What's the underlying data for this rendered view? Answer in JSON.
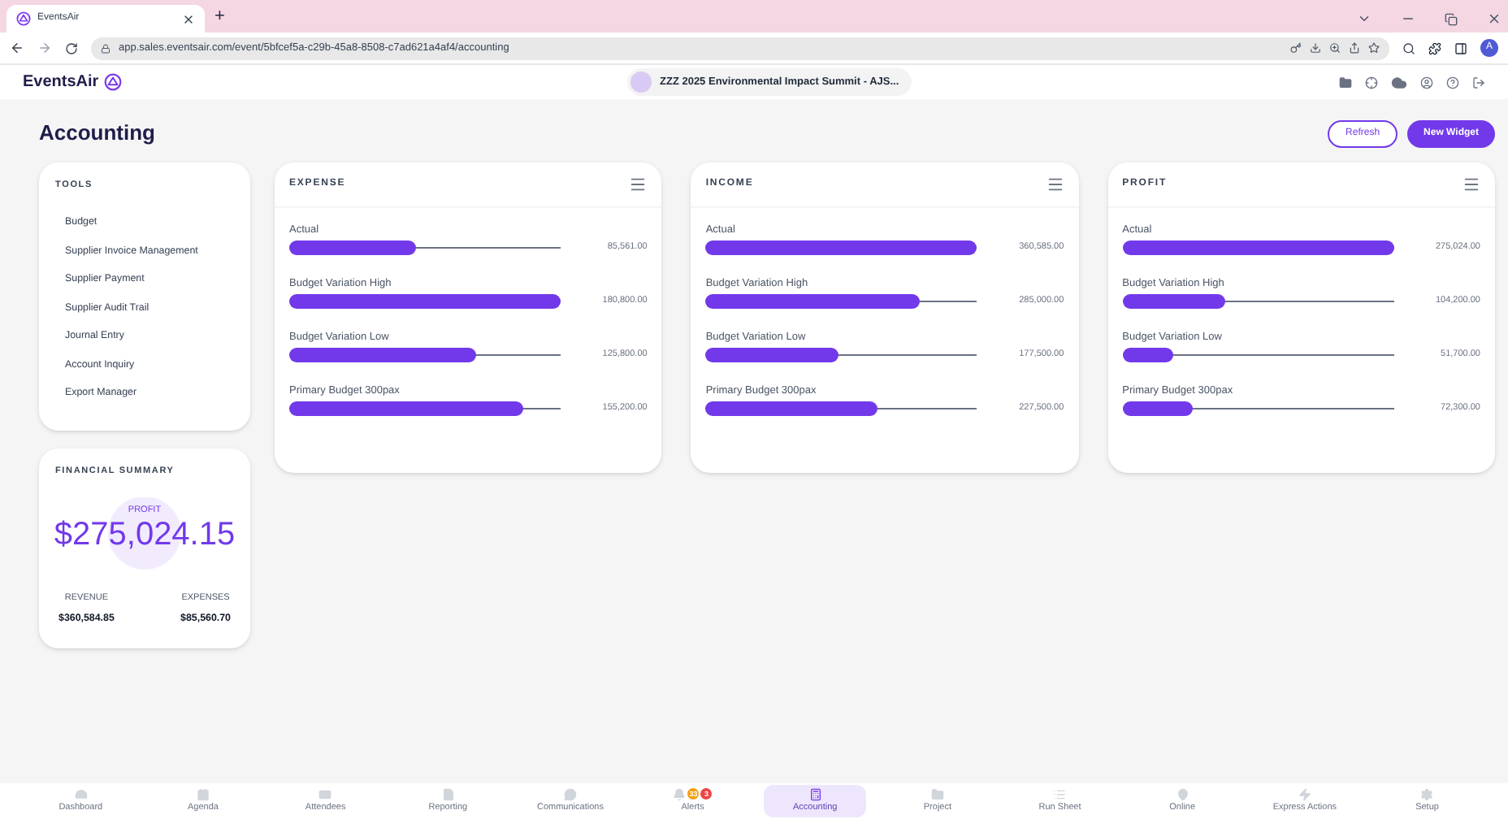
{
  "browser": {
    "tab_title": "EventsAir",
    "new_tab": "+",
    "url": "app.sales.eventsair.com/event/5bfcef5a-c29b-45a8-8508-c7ad621a4af4/accounting",
    "profile": "A"
  },
  "app": {
    "brand": "EventsAir",
    "event": "ZZZ 2025 Environmental Impact Summit - AJS..."
  },
  "page": {
    "title": "Accounting",
    "buttons": [
      {
        "label": "Refresh",
        "kind": "outline"
      },
      {
        "label": "New Widget",
        "kind": "primary"
      }
    ]
  },
  "tools": {
    "title": "TOOLS",
    "items": [
      "Budget",
      "Supplier Invoice Management",
      "Supplier Payment",
      "Supplier Audit Trail",
      "Journal Entry",
      "Account Inquiry",
      "Export Manager"
    ]
  },
  "financial_summary": {
    "title": "FINANCIAL SUMMARY",
    "profit_label": "PROFIT",
    "profit": "$275,024.15",
    "revenue_label": "REVENUE",
    "revenue": "$360,584.85",
    "expenses_label": "EXPENSES",
    "expenses": "$85,560.70"
  },
  "widgets": [
    {
      "title": "EXPENSE",
      "rows": [
        {
          "label": "Actual",
          "level": 0.47,
          "value": "85,561.00"
        },
        {
          "label": "Budget Variation High",
          "level": 1.0,
          "value": "180,800.00"
        },
        {
          "label": "Budget Variation Low",
          "level": 0.69,
          "value": "125,800.00"
        },
        {
          "label": "Primary Budget 300pax",
          "level": 0.86,
          "value": "155,200.00"
        }
      ]
    },
    {
      "title": "INCOME",
      "rows": [
        {
          "label": "Actual",
          "level": 1.0,
          "value": "360,585.00"
        },
        {
          "label": "Budget Variation High",
          "level": 0.79,
          "value": "285,000.00"
        },
        {
          "label": "Budget Variation Low",
          "level": 0.49,
          "value": "177,500.00"
        },
        {
          "label": "Primary Budget 300pax",
          "level": 0.63,
          "value": "227,500.00"
        }
      ]
    },
    {
      "title": "PROFIT",
      "rows": [
        {
          "label": "Actual",
          "level": 1.0,
          "value": "275,024.00"
        },
        {
          "label": "Budget Variation High",
          "level": 0.38,
          "value": "104,200.00"
        },
        {
          "label": "Budget Variation Low",
          "level": 0.19,
          "value": "51,700.00"
        },
        {
          "label": "Primary Budget 300pax",
          "level": 0.26,
          "value": "72,300.00"
        }
      ]
    }
  ],
  "bottom_nav": [
    {
      "label": "Dashboard",
      "selected": false
    },
    {
      "label": "Agenda",
      "selected": false
    },
    {
      "label": "Attendees",
      "selected": false
    },
    {
      "label": "Reporting",
      "selected": false
    },
    {
      "label": "Communications",
      "selected": false
    },
    {
      "label": "Alerts",
      "selected": false,
      "badges": [
        {
          "text": "33",
          "color": "#f59e0b"
        },
        {
          "text": "3",
          "color": "#ef4444"
        }
      ]
    },
    {
      "label": "Accounting",
      "selected": true
    },
    {
      "label": "Project",
      "selected": false
    },
    {
      "label": "Run Sheet",
      "selected": false
    },
    {
      "label": "Online",
      "selected": false
    },
    {
      "label": "Express Actions",
      "selected": false
    },
    {
      "label": "Setup",
      "selected": false
    }
  ]
}
